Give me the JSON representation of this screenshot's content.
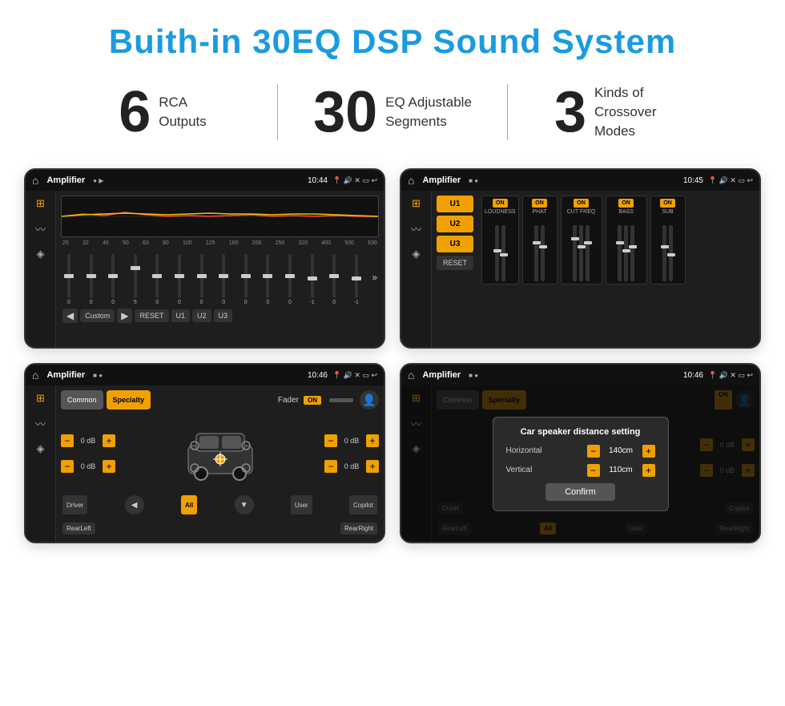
{
  "header": {
    "title": "Buith-in 30EQ DSP Sound System"
  },
  "stats": [
    {
      "number": "6",
      "label_line1": "RCA",
      "label_line2": "Outputs"
    },
    {
      "number": "30",
      "label_line1": "EQ Adjustable",
      "label_line2": "Segments"
    },
    {
      "number": "3",
      "label_line1": "Kinds of",
      "label_line2": "Crossover Modes"
    }
  ],
  "screens": {
    "eq_screen": {
      "title": "Amplifier",
      "time": "10:44",
      "freq_labels": [
        "25",
        "32",
        "40",
        "50",
        "63",
        "80",
        "100",
        "125",
        "160",
        "200",
        "250",
        "320",
        "400",
        "500",
        "630"
      ],
      "slider_values": [
        "0",
        "0",
        "0",
        "5",
        "0",
        "0",
        "0",
        "0",
        "0",
        "0",
        "0",
        "-1",
        "0",
        "-1"
      ],
      "bottom_buttons": [
        "Custom",
        "RESET",
        "U1",
        "U2",
        "U3"
      ]
    },
    "dsp_screen": {
      "title": "Amplifier",
      "time": "10:45",
      "u_buttons": [
        "U1",
        "U2",
        "U3"
      ],
      "channels": [
        {
          "label": "LOUDNESS",
          "on": true
        },
        {
          "label": "PHAT",
          "on": true
        },
        {
          "label": "CUT FREQ",
          "on": true
        },
        {
          "label": "BASS",
          "on": true
        },
        {
          "label": "SUB",
          "on": true
        }
      ],
      "reset_label": "RESET"
    },
    "crossover_screen": {
      "title": "Amplifier",
      "time": "10:46",
      "tabs": [
        "Common",
        "Specialty"
      ],
      "active_tab": "Specialty",
      "fader_label": "Fader",
      "on_label": "ON",
      "buttons": [
        "Driver",
        "All",
        "User",
        "Copilot",
        "RearLeft",
        "RearRight"
      ],
      "vol_left_top": "0 dB",
      "vol_right_top": "0 dB",
      "vol_left_bottom": "0 dB",
      "vol_right_bottom": "0 dB"
    },
    "dialog_screen": {
      "title": "Amplifier",
      "time": "10:46",
      "tabs": [
        "Common",
        "Specialty"
      ],
      "dialog": {
        "title": "Car speaker distance setting",
        "horizontal_label": "Horizontal",
        "horizontal_value": "140cm",
        "vertical_label": "Vertical",
        "vertical_value": "110cm",
        "confirm_label": "Confirm"
      },
      "vol_right_top": "0 dB",
      "vol_right_bottom": "0 dB"
    }
  }
}
